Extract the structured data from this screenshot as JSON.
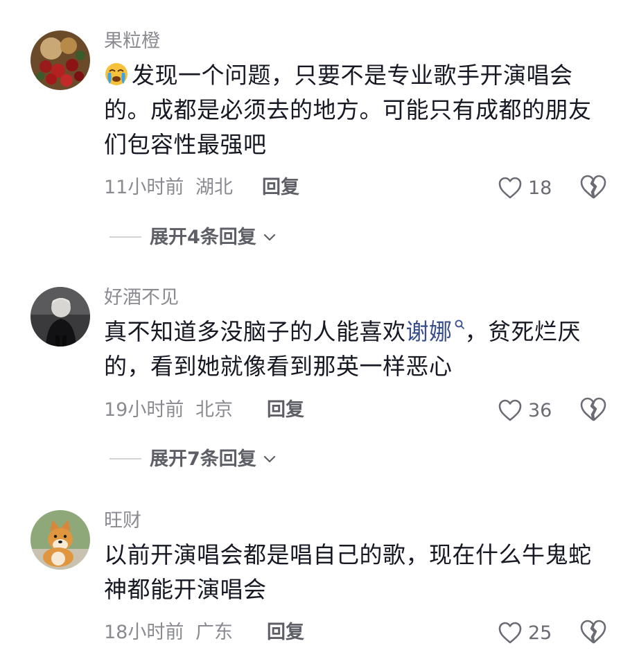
{
  "comments": [
    {
      "username": "果粒橙",
      "text": "发现一个问题，只要不是专业歌手开演唱会的。成都是必须去的地方。可能只有成都的朋友们包容性最强吧",
      "time": "11小时前",
      "location": "湖北",
      "reply_label": "回复",
      "likes": "18",
      "expand_label": "展开4条回复",
      "emoji_icon": "crying-face-emoji"
    },
    {
      "username": "好酒不见",
      "text_before": "真不知道多没脑子的人能喜欢",
      "link_text": "谢娜",
      "text_after": "，贫死烂厌的，看到她就像看到那英一样恶心",
      "time": "19小时前",
      "location": "北京",
      "reply_label": "回复",
      "likes": "36",
      "expand_label": "展开7条回复"
    },
    {
      "username": "旺财",
      "text": "以前开演唱会都是唱自己的歌，现在什么牛鬼蛇神都能开演唱会",
      "time": "18小时前",
      "location": "广东",
      "reply_label": "回复",
      "likes": "25"
    }
  ],
  "colors": {
    "text": "#161823",
    "secondary": "#8a8b91",
    "reply": "#5d5e66",
    "link": "#3a4e8c"
  }
}
